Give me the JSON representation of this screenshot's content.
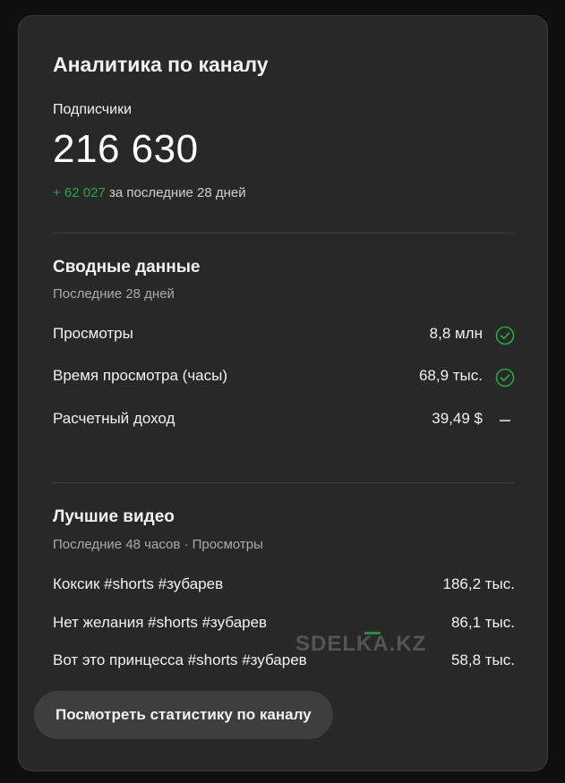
{
  "card": {
    "title": "Аналитика по каналу",
    "subscribers": {
      "label": "Подписчики",
      "count": "216 630",
      "delta": "+ 62 027",
      "delta_period": "за последние 28 дней"
    },
    "summary": {
      "title": "Сводные данные",
      "period": "Последние 28 дней",
      "rows": [
        {
          "label": "Просмотры",
          "value": "8,8 млн",
          "status_icon": "check-circle-icon"
        },
        {
          "label": "Время просмотра (часы)",
          "value": "68,9 тыс.",
          "status_icon": "check-circle-icon"
        },
        {
          "label": "Расчетный доход",
          "value": "39,49 $",
          "status_icon": "dash-icon"
        }
      ]
    },
    "top_videos": {
      "title": "Лучшие видео",
      "period": "Последние 48 часов · Просмотры",
      "rows": [
        {
          "label": "Коксик #shorts #зубарев",
          "value": "186,2 тыс."
        },
        {
          "label": "Нет желания #shorts #зубарев",
          "value": "86,1 тыс."
        },
        {
          "label": "Вот это принцесса #shorts #зубарев",
          "value": "58,8 тыс."
        }
      ]
    },
    "button_label": "Посмотреть статистику по каналу"
  },
  "watermark": "SDELKA.KZ",
  "colors": {
    "background": "#0f0f0f",
    "card": "#282828",
    "accent_green": "#2ba640",
    "button": "#3e3e3e"
  }
}
